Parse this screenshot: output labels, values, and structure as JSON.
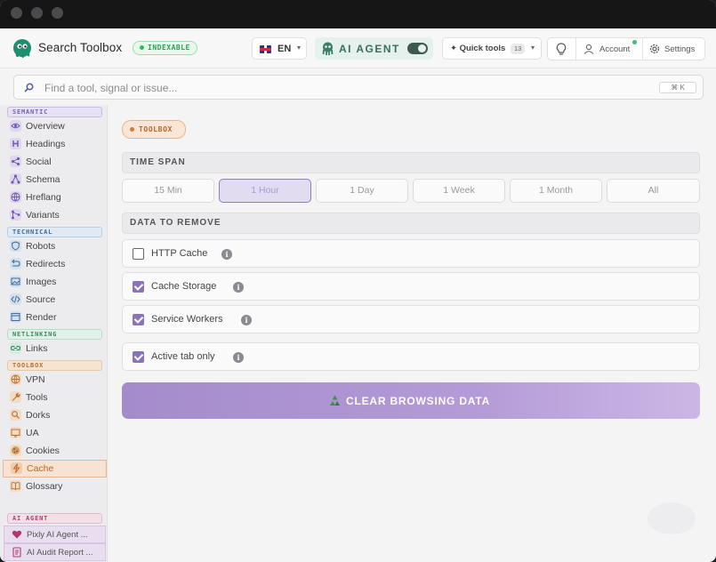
{
  "header": {
    "brand": "Search Toolbox",
    "indexable_badge": "INDEXABLE",
    "language": "EN",
    "ai_agent_label": "AI AGENT",
    "ai_agent_enabled": true,
    "quick_tools_label": "✦ Quick tools",
    "quick_tools_count": "13",
    "account_label": "Account",
    "settings_label": "Settings"
  },
  "search": {
    "placeholder": "Find a tool, signal or issue...",
    "value": "",
    "shortcut": "⌘ K"
  },
  "sidebar": {
    "sections": [
      {
        "label": "SEMANTIC",
        "items": [
          "Overview",
          "Headings",
          "Social",
          "Schema",
          "Hreflang",
          "Variants"
        ]
      },
      {
        "label": "TECHNICAL",
        "items": [
          "Robots",
          "Redirects",
          "Images",
          "Source",
          "Render"
        ]
      },
      {
        "label": "NETLINKING",
        "items": [
          "Links"
        ]
      },
      {
        "label": "TOOLBOX",
        "items": [
          "VPN",
          "Tools",
          "Dorks",
          "UA",
          "Cookies",
          "Cache",
          "Glossary"
        ]
      },
      {
        "label": "AI AGENT",
        "items": [
          "Pixly AI Agent ...",
          "AI Audit Report ..."
        ]
      }
    ],
    "active_item": "Cache"
  },
  "main": {
    "tag": "TOOLBOX",
    "time_span_title": "TIME SPAN",
    "time_spans": [
      "15 Min",
      "1 Hour",
      "1 Day",
      "1 Week",
      "1 Month",
      "All"
    ],
    "selected_time_span": "1 Hour",
    "data_title": "DATA TO REMOVE",
    "options": [
      {
        "label": "HTTP Cache",
        "checked": false
      },
      {
        "label": "Cache Storage",
        "checked": true
      },
      {
        "label": "Service Workers",
        "checked": true
      },
      {
        "label": "Active tab only",
        "checked": true
      }
    ],
    "info_glyph": "i",
    "clear_button": "CLEAR BROWSING DATA"
  },
  "colors": {
    "accent": "#8a72bd",
    "indexable": "#29a354",
    "toolbox": "#b5662b"
  }
}
